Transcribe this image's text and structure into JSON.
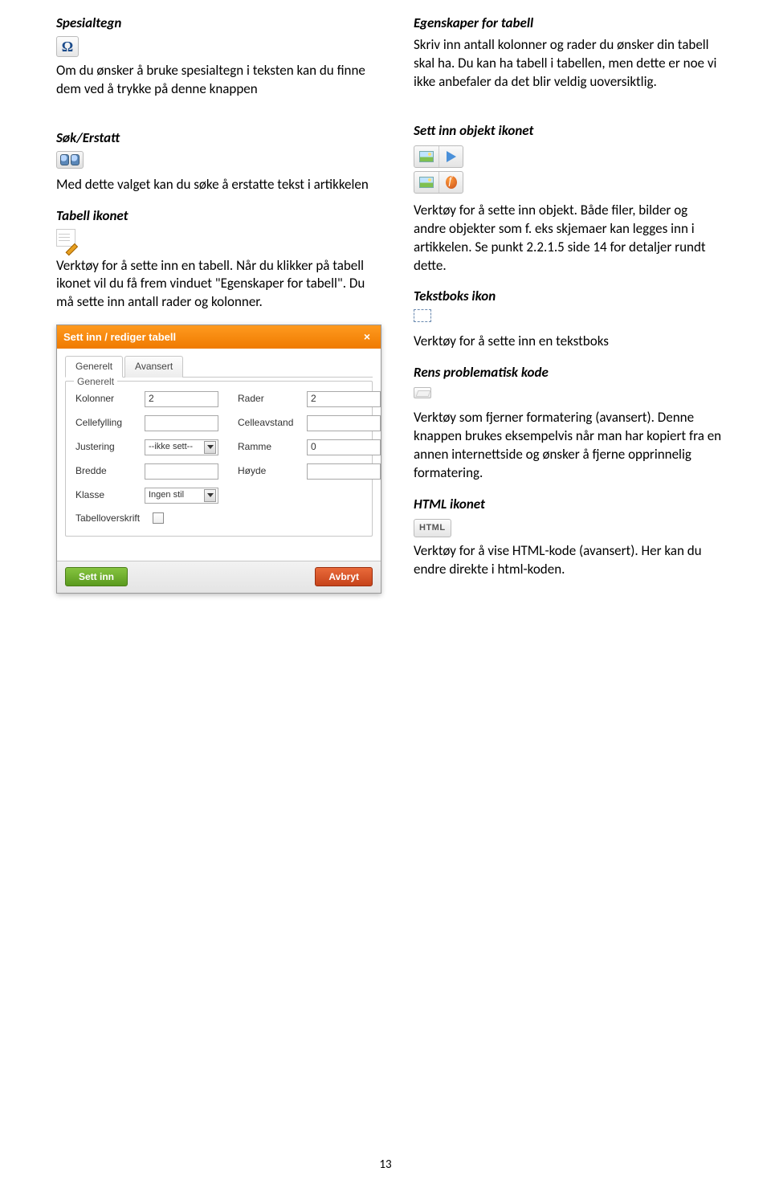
{
  "left": {
    "h1_title": "Spesialtegn",
    "h1_body": "Om du ønsker å bruke spesialtegn i teksten kan du finne dem ved å trykke på denne knappen",
    "h2_title": "Søk/Erstatt",
    "h2_body": "Med dette valget kan du søke å erstatte tekst i artikkelen",
    "h3_title": "Tabell ikonet",
    "h3_body": "Verktøy for å sette inn en tabell. Når du klikker på tabell ikonet vil du få frem vinduet \"Egenskaper for tabell\". Du må sette inn antall rader og kolonner.",
    "omega": "Ω"
  },
  "dialog": {
    "title": "Sett inn / rediger tabell",
    "tab_general": "Generelt",
    "tab_advanced": "Avansert",
    "legend": "Generelt",
    "lbl_kolonner": "Kolonner",
    "val_kolonner": "2",
    "lbl_rader": "Rader",
    "val_rader": "2",
    "lbl_cellefylling": "Cellefylling",
    "lbl_celleavstand": "Celleavstand",
    "lbl_justering": "Justering",
    "val_justering": "--ikke sett--",
    "lbl_ramme": "Ramme",
    "val_ramme": "0",
    "lbl_bredde": "Bredde",
    "lbl_hoyde": "Høyde",
    "lbl_klasse": "Klasse",
    "val_klasse": "Ingen stil",
    "lbl_tabelloverskrift": "Tabelloverskrift",
    "btn_insert": "Sett inn",
    "btn_cancel": "Avbryt"
  },
  "right": {
    "r1_title": "Egenskaper for tabell",
    "r1_body": "Skriv inn antall kolonner og rader du ønsker din tabell skal ha. Du kan ha tabell i tabellen, men dette er noe vi ikke anbefaler da det blir veldig uoversiktlig.",
    "r2_title": "Sett inn objekt ikonet",
    "r2_body": "Verktøy for å sette inn objekt. Både filer, bilder og andre objekter som f. eks skjemaer kan legges inn i artikkelen. Se punkt 2.2.1.5 side 14 for detaljer rundt dette.",
    "r3_title": "Tekstboks ikon",
    "r3_body": "Verktøy for å sette inn en tekstboks",
    "r4_title": "Rens problematisk kode",
    "r4_body": "Verktøy som fjerner formatering (avansert). Denne knappen brukes eksempelvis når man har kopiert fra en annen internettside og ønsker å fjerne opprinnelig formatering.",
    "r5_title": "HTML ikonet",
    "r5_body": "Verktøy for å vise HTML-kode (avansert). Her kan du endre direkte i html-koden.",
    "html_label": "HTML"
  },
  "page_number": "13"
}
